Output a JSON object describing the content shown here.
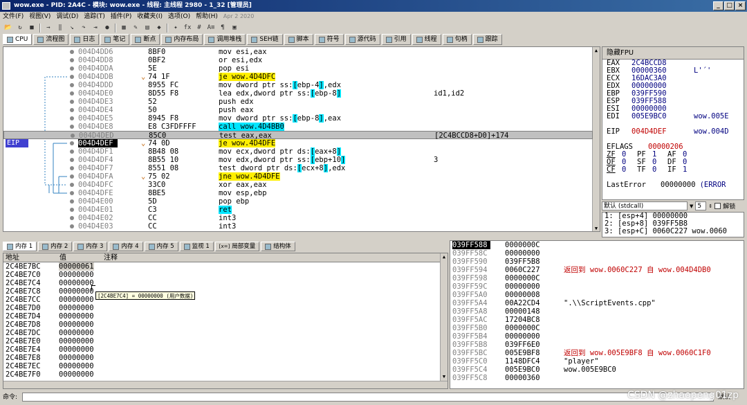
{
  "window": {
    "title": "wow.exe - PID: 2A4C - 模块: wow.exe - 线程: 主线程 2980 - 1_32 [管理员]"
  },
  "menu": [
    "文件(F)",
    "视图(V)",
    "调试(D)",
    "追踪(T)",
    "插件(P)",
    "收藏夹(I)",
    "选项(O)",
    "帮助(H)"
  ],
  "menu_date": "Apr 2 2020",
  "toolbar_icons": [
    "open-icon",
    "restart-icon",
    "close-icon",
    "run-icon",
    "pause-icon",
    "step-into-icon",
    "step-over-icon",
    "run-to-return-icon",
    "breakpoint-icon",
    "memory-icon",
    "highlight-icon",
    "patch-icon",
    "comment-icon",
    "label-icon",
    "fx-icon",
    "hash-icon",
    "font-icon",
    "scripts-icon",
    "calc-icon"
  ],
  "toolbar_fx": "fx",
  "toolbar_hash": "#",
  "toolbar_font": "A≡",
  "tabs": [
    "CPU",
    "流程图",
    "日志",
    "笔记",
    "断点",
    "内存布局",
    "调用堆栈",
    "SEH链",
    "脚本",
    "符号",
    "源代码",
    "引用",
    "线程",
    "句柄",
    "跟踪"
  ],
  "disasm": {
    "eip_label": "EIP",
    "rows": [
      {
        "addr": "004D4DD6",
        "hex": "8BF0",
        "dis": "mov esi,eax",
        "cmt": ""
      },
      {
        "addr": "004D4DD8",
        "hex": "0BF2",
        "dis": "or esi,edx",
        "cmt": ""
      },
      {
        "addr": "004D4DDA",
        "hex": "5E",
        "dis": "pop esi",
        "cmt": ""
      },
      {
        "addr": "004D4DDB",
        "hex": "74 1F",
        "dis": "je wow.4D4DFC",
        "cmt": ""
      },
      {
        "addr": "004D4DDD",
        "hex": "8955 FC",
        "dis": "mov dword ptr ss:[ebp-4],edx",
        "cmt": ""
      },
      {
        "addr": "004D4DE0",
        "hex": "8D55 F8",
        "dis": "lea edx,dword ptr ss:[ebp-8]",
        "cmt": "id1,id2"
      },
      {
        "addr": "004D4DE3",
        "hex": "52",
        "dis": "push edx",
        "cmt": ""
      },
      {
        "addr": "004D4DE4",
        "hex": "50",
        "dis": "push eax",
        "cmt": ""
      },
      {
        "addr": "004D4DE5",
        "hex": "8945 F8",
        "dis": "mov dword ptr ss:[ebp-8],eax",
        "cmt": ""
      },
      {
        "addr": "004D4DE8",
        "hex": "E8 C3FDFFFF",
        "dis": "call wow.4D4BB0",
        "cmt": ""
      },
      {
        "addr": "004D4DED",
        "hex": "85C0",
        "dis": "test eax,eax",
        "cmt": "[2C4BCCD8+D0]+174"
      },
      {
        "addr": "004D4DEF",
        "hex": "74 0D",
        "dis": "je wow.4D4DFE",
        "cmt": ""
      },
      {
        "addr": "004D4DF1",
        "hex": "8B48 08",
        "dis": "mov ecx,dword ptr ds:[eax+8]",
        "cmt": ""
      },
      {
        "addr": "004D4DF4",
        "hex": "8B55 10",
        "dis": "mov edx,dword ptr ss:[ebp+10]",
        "cmt": "3"
      },
      {
        "addr": "004D4DF7",
        "hex": "8551 08",
        "dis": "test dword ptr ds:[ecx+8],edx",
        "cmt": ""
      },
      {
        "addr": "004D4DFA",
        "hex": "75 02",
        "dis": "jne wow.4D4DFE",
        "cmt": ""
      },
      {
        "addr": "004D4DFC",
        "hex": "33C0",
        "dis": "xor eax,eax",
        "cmt": ""
      },
      {
        "addr": "004D4DFE",
        "hex": "8BE5",
        "dis": "mov esp,ebp",
        "cmt": ""
      },
      {
        "addr": "004D4E00",
        "hex": "5D",
        "dis": "pop ebp",
        "cmt": ""
      },
      {
        "addr": "004D4E01",
        "hex": "C3",
        "dis": "ret",
        "cmt": ""
      },
      {
        "addr": "004D4E02",
        "hex": "CC",
        "dis": "int3",
        "cmt": ""
      },
      {
        "addr": "004D4E03",
        "hex": "CC",
        "dis": "int3",
        "cmt": ""
      }
    ]
  },
  "fpu": {
    "header": "隐藏FPU",
    "regs": [
      {
        "n": "EAX",
        "v": "2C4BCCD8",
        "x": ""
      },
      {
        "n": "EBX",
        "v": "00000360",
        "x": "L'´'"
      },
      {
        "n": "ECX",
        "v": "16DAC3A0",
        "x": ""
      },
      {
        "n": "EDX",
        "v": "00000000",
        "x": ""
      },
      {
        "n": "EBP",
        "v": "039FF590",
        "x": ""
      },
      {
        "n": "ESP",
        "v": "039FF588",
        "x": ""
      },
      {
        "n": "ESI",
        "v": "00000000",
        "x": ""
      },
      {
        "n": "EDI",
        "v": "005E9BC0",
        "x": "wow.005E"
      }
    ],
    "eip": {
      "n": "EIP",
      "v": "004D4DEF",
      "x": "wow.004D"
    },
    "eflags": {
      "n": "EFLAGS",
      "v": "00000206"
    },
    "flags": [
      [
        "ZF",
        "0",
        "PF",
        "1",
        "AF",
        "0"
      ],
      [
        "OF",
        "0",
        "SF",
        "0",
        "DF",
        "0"
      ],
      [
        "CF",
        "0",
        "TF",
        "0",
        "IF",
        "1"
      ]
    ],
    "lasterror": {
      "n": "LastError",
      "v": "00000000",
      "x": "(ERROR"
    }
  },
  "conv": {
    "value": "默认 (stdcall)",
    "count": "5",
    "unlock": "解锁"
  },
  "stack_args": [
    "1: [esp+4] 00000000",
    "2: [esp+8] 039FF5B8",
    "3: [esp+C] 0060C227 wow.0060"
  ],
  "memtabs": [
    "内存 1",
    "内存 2",
    "内存 3",
    "内存 4",
    "内存 5",
    "监视 1",
    "局部变量",
    "结构体"
  ],
  "memtab_icons": [
    "[x=]"
  ],
  "dump": {
    "cols": [
      "地址",
      "值",
      "注释"
    ],
    "rows": [
      {
        "a": "2C4BE7BC",
        "v": "00000061"
      },
      {
        "a": "2C4BE7C0",
        "v": "00000000"
      },
      {
        "a": "2C4BE7C4",
        "v": "00000000"
      },
      {
        "a": "2C4BE7C8",
        "v": "00000000"
      },
      {
        "a": "2C4BE7CC",
        "v": "00000000"
      },
      {
        "a": "2C4BE7D0",
        "v": "00000000"
      },
      {
        "a": "2C4BE7D4",
        "v": "00000000"
      },
      {
        "a": "2C4BE7D8",
        "v": "00000000"
      },
      {
        "a": "2C4BE7DC",
        "v": "00000000"
      },
      {
        "a": "2C4BE7E0",
        "v": "00000000"
      },
      {
        "a": "2C4BE7E4",
        "v": "00000000"
      },
      {
        "a": "2C4BE7E8",
        "v": "00000000"
      },
      {
        "a": "2C4BE7EC",
        "v": "00000000"
      },
      {
        "a": "2C4BE7F0",
        "v": "00000000"
      }
    ],
    "tooltip": "[2C4BE7C4] = 00000000 (用户数据)"
  },
  "stack": {
    "rows": [
      {
        "a": "039FF588",
        "v": "0000000C",
        "c": "",
        "ret": false
      },
      {
        "a": "039FF58C",
        "v": "00000000",
        "c": "",
        "ret": false
      },
      {
        "a": "039FF590",
        "v": "039FF5B8",
        "c": "",
        "ret": false
      },
      {
        "a": "039FF594",
        "v": "0060C227",
        "c": "返回到 wow.0060C227 自 wow.004D4DB0",
        "ret": true
      },
      {
        "a": "039FF598",
        "v": "0000000C",
        "c": "",
        "ret": false
      },
      {
        "a": "039FF59C",
        "v": "00000000",
        "c": "",
        "ret": false
      },
      {
        "a": "039FF5A0",
        "v": "00000008",
        "c": "",
        "ret": false
      },
      {
        "a": "039FF5A4",
        "v": "00A22CD4",
        "c": "\".\\\\ScriptEvents.cpp\"",
        "ret": false
      },
      {
        "a": "039FF5A8",
        "v": "00000148",
        "c": "",
        "ret": false
      },
      {
        "a": "039FF5AC",
        "v": "17204BC8",
        "c": "",
        "ret": false
      },
      {
        "a": "039FF5B0",
        "v": "0000000C",
        "c": "",
        "ret": false
      },
      {
        "a": "039FF5B4",
        "v": "00000000",
        "c": "",
        "ret": false
      },
      {
        "a": "039FF5B8",
        "v": "039FF6E0",
        "c": "",
        "ret": false
      },
      {
        "a": "039FF5BC",
        "v": "005E9BF8",
        "c": "返回到 wow.005E9BF8 自 wow.0060C1F0",
        "ret": true
      },
      {
        "a": "039FF5C0",
        "v": "1148DFC4",
        "c": "\"player\"",
        "ret": false
      },
      {
        "a": "039FF5C4",
        "v": "005E9BC0",
        "c": "wow.005E9BC0",
        "ret": false
      },
      {
        "a": "039FF5C8",
        "v": "00000360",
        "c": "",
        "ret": false
      }
    ]
  },
  "command": {
    "label": "命令:",
    "default_label": "默认"
  },
  "watermark": "CSDN @zhaopeng01zp"
}
